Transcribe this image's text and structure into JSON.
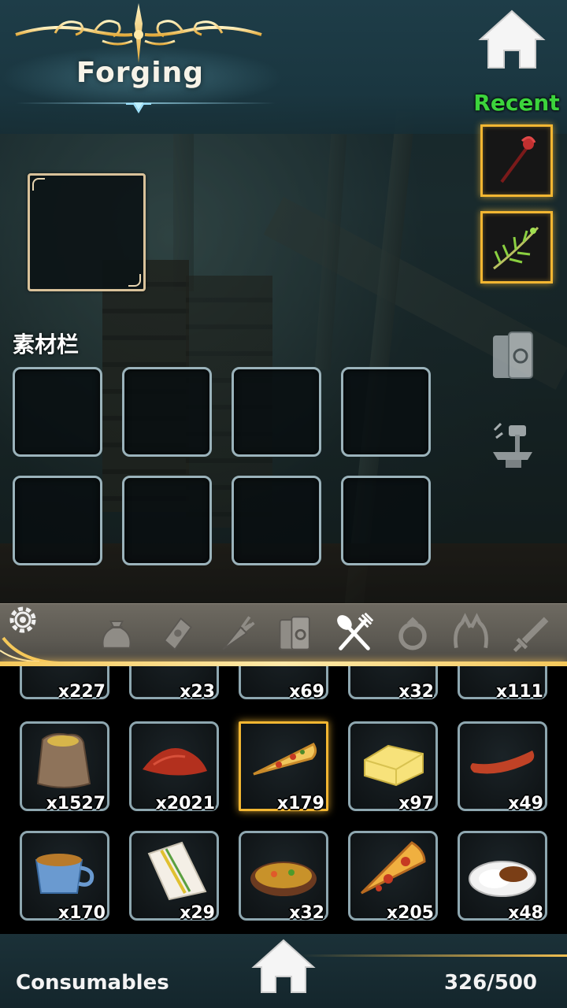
{
  "header": {
    "title": "Forging",
    "recent_label": "Recent"
  },
  "materials": {
    "label": "素材栏"
  },
  "categories": [
    {
      "name": "bag-icon"
    },
    {
      "name": "scroll-icon"
    },
    {
      "name": "carrot-icon"
    },
    {
      "name": "books-icon"
    },
    {
      "name": "fork-spoon-icon",
      "active": true
    },
    {
      "name": "ring-icon"
    },
    {
      "name": "cat-ears-icon"
    },
    {
      "name": "sword-icon"
    }
  ],
  "inventory": {
    "partial_row": [
      "x227",
      "x23",
      "x69",
      "x32",
      "x111"
    ],
    "row1": [
      {
        "count": "x1527",
        "icon": "flour-sack-icon"
      },
      {
        "count": "x2021",
        "icon": "chili-powder-icon"
      },
      {
        "count": "x179",
        "icon": "pizza-slice-icon",
        "selected": true
      },
      {
        "count": "x97",
        "icon": "butter-icon"
      },
      {
        "count": "x49",
        "icon": "sausage-icon"
      }
    ],
    "row2": [
      {
        "count": "x170",
        "icon": "soup-cup-icon"
      },
      {
        "count": "x29",
        "icon": "sandwich-icon"
      },
      {
        "count": "x32",
        "icon": "stew-bowl-icon"
      },
      {
        "count": "x205",
        "icon": "pepperoni-pizza-icon"
      },
      {
        "count": "x48",
        "icon": "curry-rice-icon"
      }
    ]
  },
  "footer": {
    "category": "Consumables",
    "capacity": "326/500"
  },
  "colors": {
    "accent_gold": "#f2b632",
    "recent_green": "#3cd43c",
    "slot_border": "#8ea7b0"
  }
}
